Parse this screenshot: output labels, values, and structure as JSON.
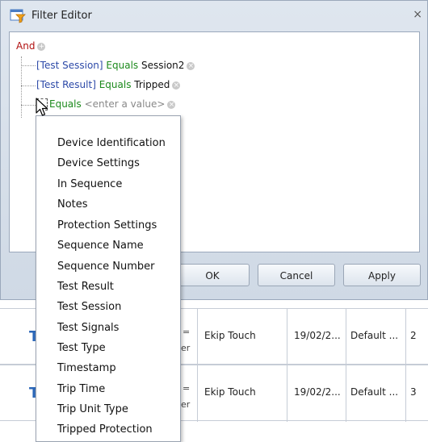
{
  "window": {
    "title": "Filter Editor",
    "close": "×"
  },
  "tree": {
    "root": "And",
    "conditions": [
      {
        "field": "[Test Session]",
        "op": "Equals",
        "value": "Session2"
      },
      {
        "field": "[Test Result]",
        "op": "Equals",
        "value": "Tripped"
      },
      {
        "field": "",
        "op": "Equals",
        "placeholder": "<enter a value>"
      }
    ]
  },
  "buttons": {
    "ok": "OK",
    "cancel": "Cancel",
    "apply": "Apply"
  },
  "menu": {
    "items": [
      "Device Identification",
      "Device Settings",
      "In Sequence",
      "Notes",
      "Protection Settings",
      "Sequence Name",
      "Sequence Number",
      "Test Result",
      "Test Session",
      "Test Signals",
      "Test Type",
      "Timestamp",
      "Trip Time",
      "Trip Unit Type",
      "Tripped Protection"
    ]
  },
  "grid": {
    "rows": [
      {
        "device": "Ekip Touch",
        "date": "19/02/2...",
        "setting": "Default ...",
        "count": "2",
        "partial1": "=",
        "partial2": "er"
      },
      {
        "device": "Ekip Touch",
        "date": "19/02/2...",
        "setting": "Default ...",
        "count": "3",
        "partial1": "=",
        "partial2": "er"
      }
    ]
  }
}
